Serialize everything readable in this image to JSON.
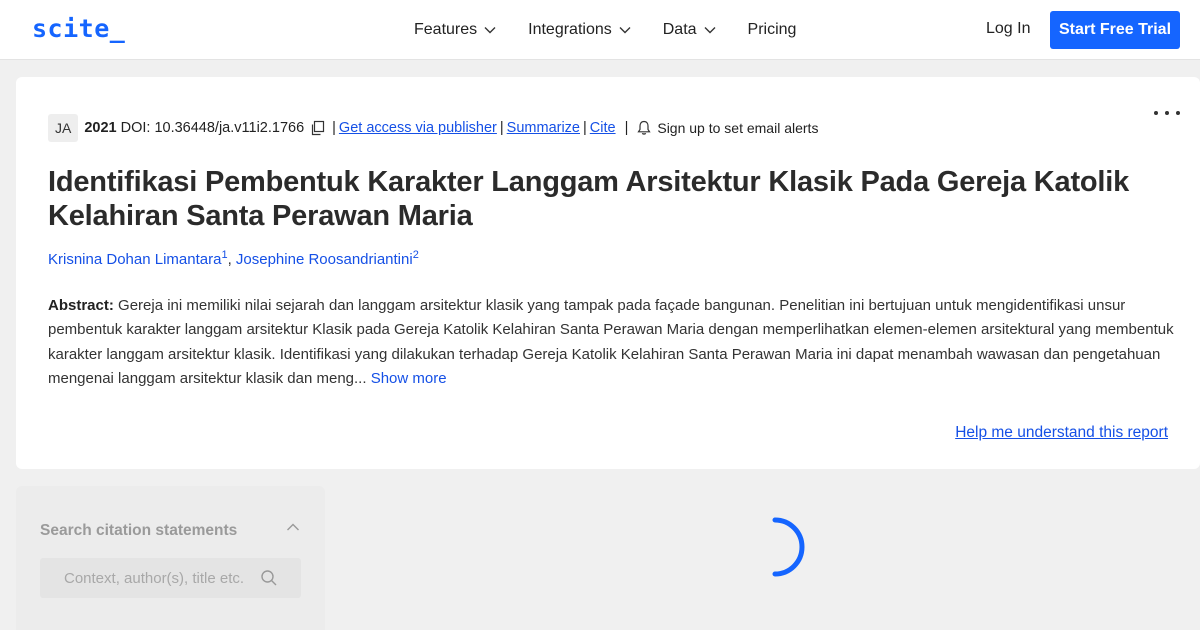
{
  "header": {
    "logo": "scite_",
    "nav": [
      {
        "label": "Features",
        "has_dropdown": true
      },
      {
        "label": "Integrations",
        "has_dropdown": true
      },
      {
        "label": "Data",
        "has_dropdown": true
      },
      {
        "label": "Pricing",
        "has_dropdown": false
      }
    ],
    "login_label": "Log In",
    "trial_label": "Start Free Trial",
    "accent_color": "#1565ff"
  },
  "paper": {
    "journal_badge": "JA",
    "year": "2021",
    "doi": "DOI: 10.36448/ja.v11i2.1766",
    "links": {
      "publisher": "Get access via publisher",
      "summarize": "Summarize",
      "cite": "Cite"
    },
    "alerts_label": "Sign up to set email alerts",
    "title": "Identifikasi Pembentuk Karakter Langgam Arsitektur Klasik Pada Gereja Katolik Kelahiran Santa Perawan Maria",
    "authors": [
      {
        "name": "Krisnina Dohan Limantara",
        "sup": "1"
      },
      {
        "name": "Josephine Roosandriantini",
        "sup": "2"
      }
    ],
    "abstract_label": "Abstract:",
    "abstract_text": "Gereja ini memiliki nilai sejarah dan langgam arsitektur klasik yang tampak pada façade bangunan. Penelitian ini bertujuan untuk mengidentifikasi unsur pembentuk karakter langgam arsitektur Klasik pada Gereja Katolik Kelahiran Santa Perawan Maria dengan memperlihatkan elemen-elemen arsitektural yang membentuk karakter langgam arsitektur klasik. Identifikasi yang dilakukan terhadap Gereja Katolik Kelahiran Santa Perawan Maria ini dapat menambah wawasan dan pengetahuan mengenai langgam arsitektur klasik dan meng...",
    "show_more": "Show more",
    "help_link": "Help me understand this report"
  },
  "sidebar": {
    "title": "Search citation statements",
    "search_placeholder": "Context, author(s), title etc."
  }
}
